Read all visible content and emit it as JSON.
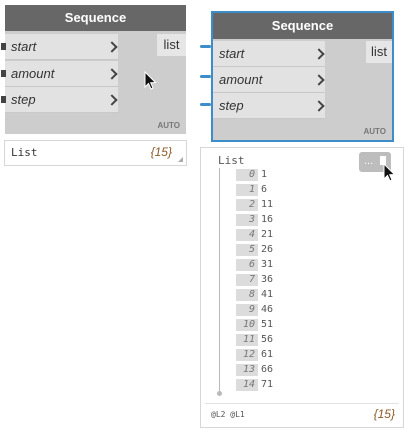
{
  "nodes": [
    {
      "title": "Sequence",
      "inputs": [
        "start",
        "amount",
        "step"
      ],
      "output": "list",
      "lacing": "AUTO"
    },
    {
      "title": "Sequence",
      "inputs": [
        "start",
        "amount",
        "step"
      ],
      "output": "list",
      "lacing": "AUTO"
    }
  ],
  "collapsed_preview": {
    "label": "List",
    "count": "{15}"
  },
  "expanded_preview": {
    "label": "List",
    "items": [
      {
        "index": "0",
        "value": "1"
      },
      {
        "index": "1",
        "value": "6"
      },
      {
        "index": "2",
        "value": "11"
      },
      {
        "index": "3",
        "value": "16"
      },
      {
        "index": "4",
        "value": "21"
      },
      {
        "index": "5",
        "value": "26"
      },
      {
        "index": "6",
        "value": "31"
      },
      {
        "index": "7",
        "value": "36"
      },
      {
        "index": "8",
        "value": "41"
      },
      {
        "index": "9",
        "value": "46"
      },
      {
        "index": "10",
        "value": "51"
      },
      {
        "index": "11",
        "value": "56"
      },
      {
        "index": "12",
        "value": "61"
      },
      {
        "index": "13",
        "value": "66"
      },
      {
        "index": "14",
        "value": "71"
      }
    ],
    "levels": "@L2 @L1",
    "count": "{15}",
    "pin_button_dots": "..."
  },
  "colors": {
    "header": "#676767",
    "port": "#e2e2e2",
    "selection": "#3c8dc9",
    "count_text": "#8c5a28"
  },
  "icons": [
    "chevron-right-icon",
    "pin-icon",
    "mouse-cursor-icon",
    "resize-grip-icon"
  ]
}
